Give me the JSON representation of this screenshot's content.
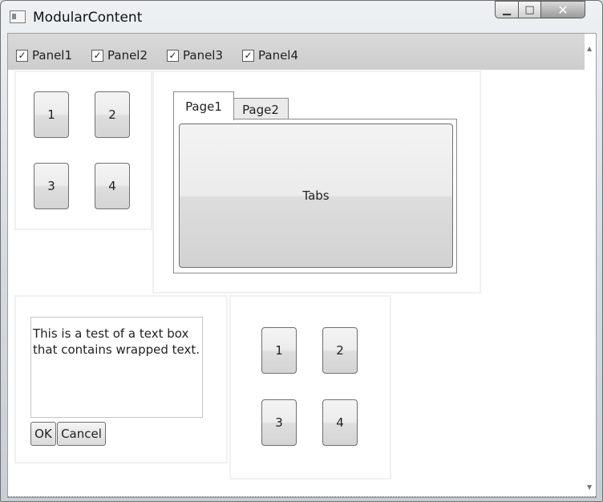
{
  "window": {
    "title": "ModularContent"
  },
  "toolbar": {
    "checkboxes": [
      {
        "label": "Panel1",
        "checked": true,
        "mark": "✓"
      },
      {
        "label": "Panel2",
        "checked": true,
        "mark": "✓"
      },
      {
        "label": "Panel3",
        "checked": true,
        "mark": "✓"
      },
      {
        "label": "Panel4",
        "checked": true,
        "mark": "✓"
      }
    ]
  },
  "panel1": {
    "buttons": [
      "1",
      "2",
      "3",
      "4"
    ]
  },
  "panel2": {
    "tabs": [
      {
        "label": "Page1",
        "selected": true
      },
      {
        "label": "Page2",
        "selected": false
      }
    ],
    "content_button": "Tabs"
  },
  "panel3": {
    "textbox_value": "This is a test of a text box that contains wrapped text.",
    "ok_label": "OK",
    "cancel_label": "Cancel"
  },
  "panel4": {
    "buttons": [
      "1",
      "2",
      "3",
      "4"
    ]
  },
  "icons": {
    "window": "app-icon",
    "minimize": "minimize-icon",
    "maximize": "maximize-icon",
    "close": "close-icon",
    "scroll_up": "scroll-up-icon",
    "scroll_down": "scroll-down-icon"
  }
}
